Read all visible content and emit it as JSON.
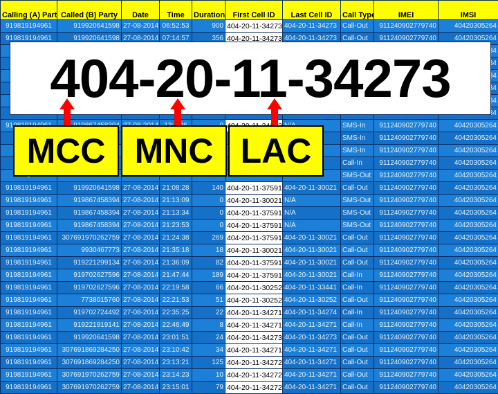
{
  "table": {
    "headers": [
      "Calling (A) Party",
      "Called (B) Party",
      "Date",
      "Time",
      "Duration",
      "First Cell ID",
      "Last Cell ID",
      "Call Type",
      "IMEI",
      "IMSI"
    ],
    "rows": [
      [
        "919819194961",
        "919920641598",
        "27-08-2014",
        "06:52:53",
        "900",
        "404-20-11-34273",
        "404-20-11-34273",
        "Call-Out",
        "911240902779740",
        "40420305264"
      ],
      [
        "919819194961",
        "919920641598",
        "27-08-2014",
        "07:14:57",
        "356",
        "404-20-11-34273",
        "404-20-11-34273",
        "Call-Out",
        "911240902779740",
        "40420305264"
      ],
      [
        "",
        "",
        "",
        "",
        "",
        "",
        "",
        "",
        "",
        "34"
      ],
      [
        "",
        "",
        "",
        "",
        "",
        "",
        "",
        "",
        "",
        "34"
      ],
      [
        "",
        "",
        "",
        "",
        "",
        "",
        "",
        "",
        "",
        "34"
      ],
      [
        "",
        "",
        "",
        "",
        "",
        "",
        "",
        "",
        "",
        "34"
      ],
      [
        "",
        "",
        "",
        "",
        "",
        "",
        "",
        "",
        "",
        "34"
      ],
      [
        "",
        "",
        "",
        "",
        "",
        "",
        "",
        "",
        "",
        "34"
      ],
      [
        "919819194961",
        "919867458394",
        "27-08-2014",
        "13:..:06",
        "0",
        "404-20-11-34273",
        "N/A",
        "SMS-In",
        "911240902779740",
        "40420305264"
      ],
      [
        "9",
        "",
        "",
        "",
        "",
        "",
        "",
        "SMS-In",
        "911240902779740",
        "40420305264"
      ],
      [
        "9",
        "",
        "",
        "",
        "",
        "",
        "",
        "SMS-In",
        "911240902779740",
        "40420305264"
      ],
      [
        "9",
        "",
        "",
        "",
        "",
        "",
        "..271",
        "Call-In",
        "911240902779740",
        "40420305264"
      ],
      [
        "9",
        "",
        "",
        "",
        "",
        "",
        "",
        "SMS-Out",
        "911240902779740",
        "40420305264"
      ],
      [
        "919819194961",
        "919920641598",
        "27-08-2014",
        "21:08:28",
        "140",
        "404-20-11-37591",
        "404-20-11-30021",
        "Call-Out",
        "911240902779740",
        "40420305264"
      ],
      [
        "919819194961",
        "919867458394",
        "27-08-2014",
        "21:13:09",
        "0",
        "404-20-11-30021",
        "N/A",
        "SMS-Out",
        "911240902779740",
        "40420305264"
      ],
      [
        "919819194961",
        "919867458394",
        "27-08-2014",
        "21:13:34",
        "0",
        "404-20-11-37591",
        "N/A",
        "SMS-Out",
        "911240902779740",
        "40420305264"
      ],
      [
        "919819194961",
        "919867458394",
        "27-08-2014",
        "21:23:53",
        "0",
        "404-20-11-37591",
        "N/A",
        "SMS-Out",
        "911240902779740",
        "40420305264"
      ],
      [
        "919819194961",
        "307691970262759",
        "27-08-2014",
        "21:24:38",
        "269",
        "404-20-11-37591",
        "404-20-11-30021",
        "Call-Out",
        "911240902779740",
        "40420305264"
      ],
      [
        "919819194961",
        "9930467773",
        "27-08-2014",
        "21:35:18",
        "18",
        "404-20-11-30021",
        "404-20-11-30021",
        "Call-Out",
        "911240902779740",
        "40420305264"
      ],
      [
        "919819194961",
        "919221299134",
        "27-08-2014",
        "21:36:09",
        "82",
        "404-20-11-37591",
        "404-20-11-30021",
        "Call-Out",
        "911240902779740",
        "40420305264"
      ],
      [
        "919819194961",
        "919702627596",
        "27-08-2014",
        "21:47:44",
        "189",
        "404-20-11-37591",
        "404-20-11-30021",
        "Call-In",
        "911240902779740",
        "40420305264"
      ],
      [
        "919819194961",
        "919702627596",
        "27-08-2014",
        "22:19:58",
        "66",
        "404-20-11-30252",
        "404-20-11-33441",
        "Call-In",
        "911240902779740",
        "40420305264"
      ],
      [
        "919819194961",
        "7738015760",
        "27-08-2014",
        "22:21:53",
        "51",
        "404-20-11-30252",
        "404-20-11-30252",
        "Call-Out",
        "911240902779740",
        "40420305264"
      ],
      [
        "919819194961",
        "919702724492",
        "27-08-2014",
        "22:35:25",
        "22",
        "404-20-11-34271",
        "404-20-11-34274",
        "Call-In",
        "911240902779740",
        "40420305264"
      ],
      [
        "919819194961",
        "919221919141",
        "27-08-2014",
        "22:46:49",
        "8",
        "404-20-11-34271",
        "404-20-11-34271",
        "Call-In",
        "911240902779740",
        "40420305264"
      ],
      [
        "919819194961",
        "919920641598",
        "27-08-2014",
        "23:01:51",
        "24",
        "404-20-11-34273",
        "404-20-11-34273",
        "Call-Out",
        "911240902779740",
        "40420305264"
      ],
      [
        "919819194961",
        "307691869284250",
        "27-08-2014",
        "23:10:42",
        "34",
        "404-20-11-34271",
        "404-20-11-34271",
        "Call-Out",
        "911240902779740",
        "40420305264"
      ],
      [
        "919819194961",
        "307691869284250",
        "27-08-2014",
        "23:13:21",
        "125",
        "404-20-11-34272",
        "404-20-11-34271",
        "Call-Out",
        "911240902779740",
        "40420305264"
      ],
      [
        "919819194961",
        "307691970262759",
        "27-08-2014",
        "23:14:23",
        "10",
        "404-20-11-34272",
        "404-20-11-34271",
        "Call-Out",
        "911240902779740",
        "40420305264"
      ],
      [
        "919819194961",
        "307691970262759",
        "27-08-2014",
        "23:15:01",
        "79",
        "404-20-11-34272",
        "404-20-11-34271",
        "Call-Out",
        "911240902779740",
        "40420305264"
      ]
    ]
  },
  "callout": {
    "cell_id": "404-20-11-34273",
    "labels": [
      "MCC",
      "MNC",
      "LAC"
    ]
  },
  "colors": {
    "header_bg": "#ffff00",
    "row_bg": "#1c7fd8",
    "arrow": "#ff0000",
    "label_bg": "#ffff00"
  }
}
